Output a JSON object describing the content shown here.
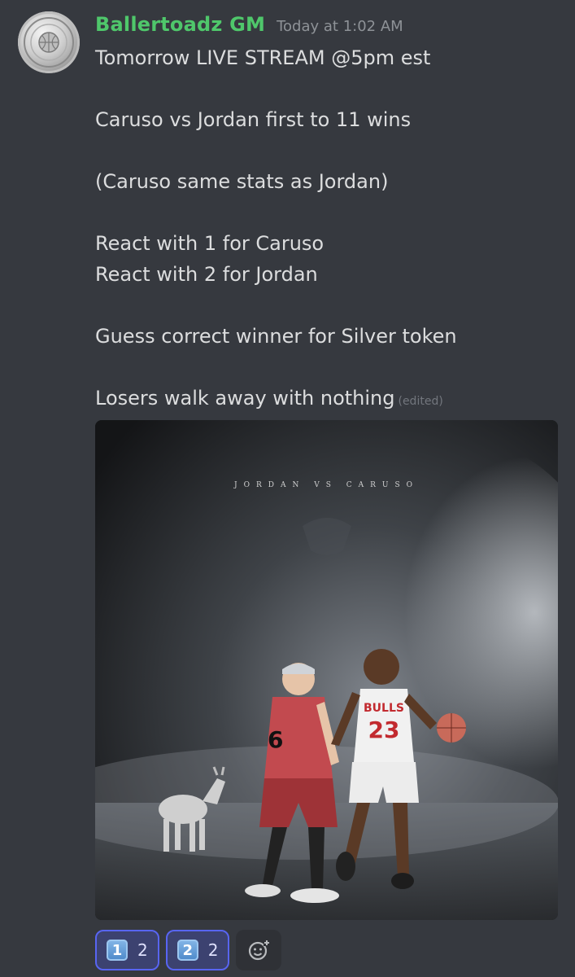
{
  "message": {
    "author": "Ballertoadz GM",
    "timestamp": "Today at 1:02 AM",
    "lines": [
      "Tomorrow LIVE STREAM @5pm est",
      "",
      "Caruso vs Jordan first to 11 wins",
      "",
      "(Caruso same stats as Jordan)",
      "",
      "React with 1 for Caruso",
      "React with 2 for Jordan",
      "",
      "Guess correct winner for Silver token",
      "",
      "Losers walk away with nothing"
    ],
    "edited_label": "(edited)"
  },
  "attachment": {
    "poster_title": "JORDAN VS CARUSO",
    "jersey_number": "23",
    "jersey_text": "BULLS"
  },
  "reactions": [
    {
      "emoji": "1",
      "count": "2"
    },
    {
      "emoji": "2",
      "count": "2"
    }
  ],
  "colors": {
    "background": "#36393f",
    "username": "#4fc76b",
    "timestamp": "#8e9297",
    "reaction_border": "#5865f2"
  },
  "icons": {
    "add_reaction": "add-reaction-icon"
  }
}
